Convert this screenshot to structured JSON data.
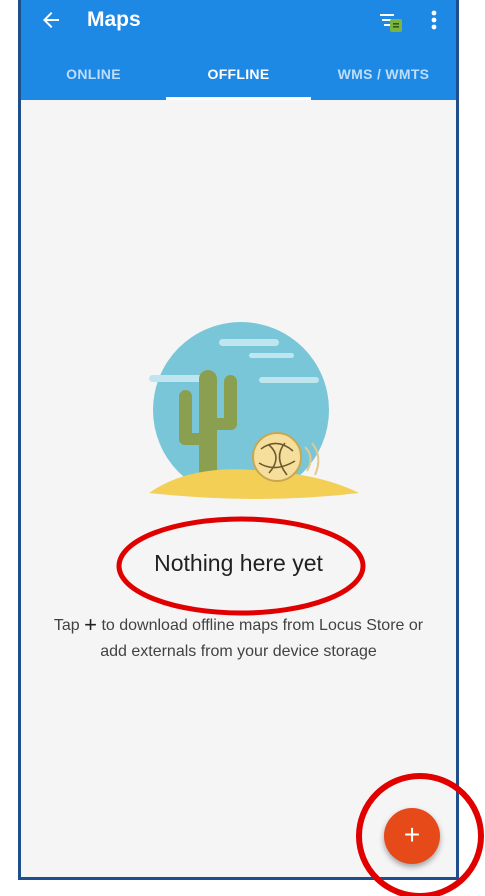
{
  "app": {
    "title": "Maps",
    "accent_color": "#1e88e5",
    "fab_color": "#e64a19"
  },
  "toolbar": {
    "back_icon": "arrow-left-icon",
    "filter_icon": "filter-list-icon",
    "more_icon": "more-vert-icon"
  },
  "tabs": [
    {
      "label": "ONLINE",
      "active": false
    },
    {
      "label": "OFFLINE",
      "active": true
    },
    {
      "label": "WMS / WMTS",
      "active": false
    }
  ],
  "empty_state": {
    "title": "Nothing here yet",
    "desc_prefix": "Tap ",
    "desc_plus": "+",
    "desc_line1": " to download offline maps from Locus Store or",
    "desc_line2": "add externals from your device storage",
    "illustration": "desert-cactus-illustration"
  },
  "fab": {
    "symbol": "+",
    "icon": "plus-icon"
  },
  "annotations": {
    "color": "#e00000"
  }
}
